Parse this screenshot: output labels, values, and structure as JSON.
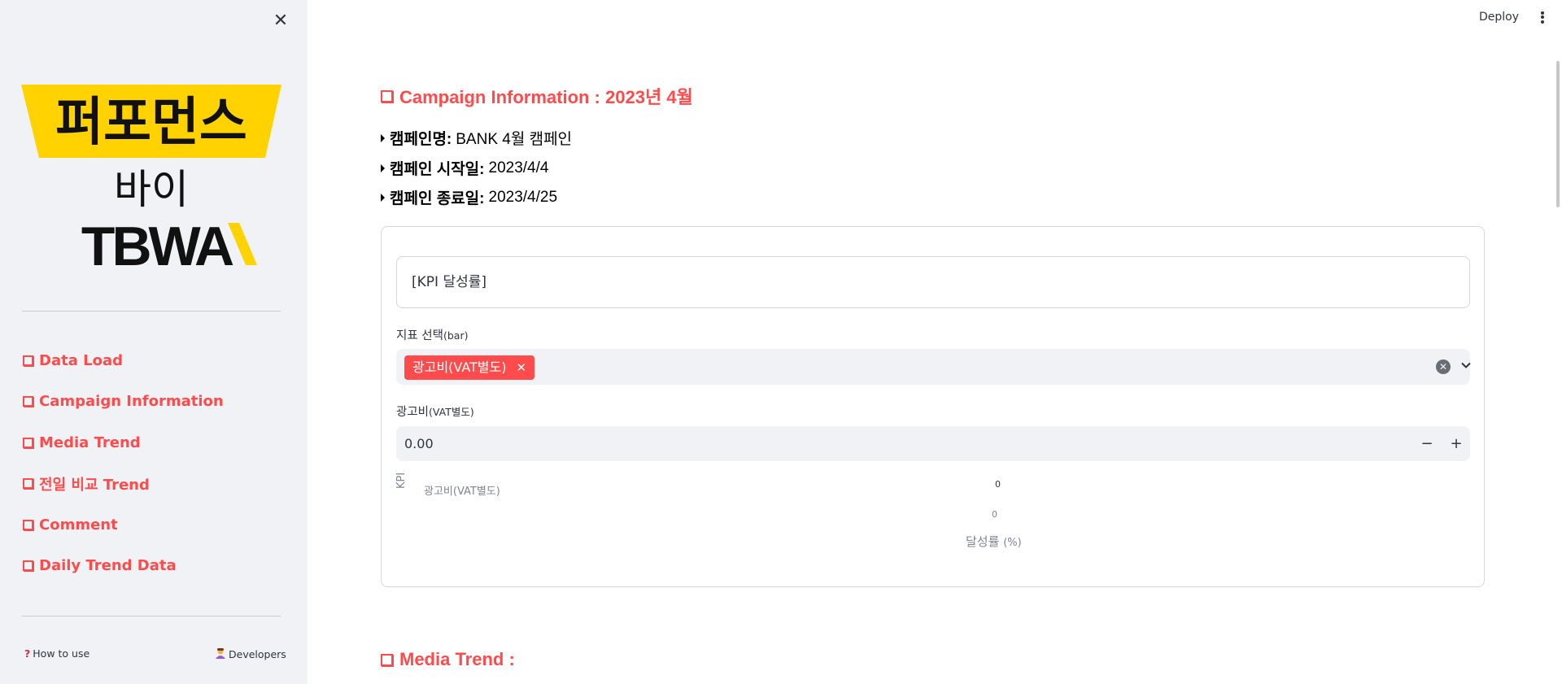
{
  "sidebar": {
    "logo": {
      "line1": "퍼포먼스",
      "line2": "바이",
      "line3": "TBWA",
      "accent_color": "#ffd200"
    },
    "nav": [
      {
        "label": "Data Load"
      },
      {
        "label": "Campaign Information"
      },
      {
        "label": "Media Trend"
      },
      {
        "label": "전일 비교 Trend"
      },
      {
        "label": "Comment"
      },
      {
        "label": "Daily Trend Data"
      }
    ],
    "footer": {
      "how_to_use": "How to use",
      "developers": "Developers"
    }
  },
  "topbar": {
    "deploy": "Deploy"
  },
  "main": {
    "campaign_title": "Campaign Information : 2023년 4월",
    "info": [
      {
        "key": "캠페인명:",
        "value": "BANK 4월 캠페인"
      },
      {
        "key": "캠페인 시작일:",
        "value": "2023/4/4"
      },
      {
        "key": "캠페인 종료일:",
        "value": "2023/4/25"
      }
    ],
    "kpi_box": "[KPI 달성률]",
    "select_label": "지표 선택",
    "select_label_suffix": "(bar)",
    "selected_tag": "광고비(VAT별도)",
    "number_label": "광고비",
    "number_label_suffix": "(VAT별도)",
    "number_value": "0.00",
    "media_trend_title": "Media Trend :"
  },
  "chart_data": {
    "type": "bar",
    "orientation": "horizontal",
    "categories": [
      "광고비(VAT별도)"
    ],
    "values": [
      0
    ],
    "data_labels": [
      "0"
    ],
    "x_ticks": [
      "0"
    ],
    "ylabel": "KPI",
    "xlabel": "달성률",
    "xlabel_unit": "(%)"
  },
  "colors": {
    "accent": "#ff4b4b",
    "sidebar_bg": "#f0f2f6"
  }
}
